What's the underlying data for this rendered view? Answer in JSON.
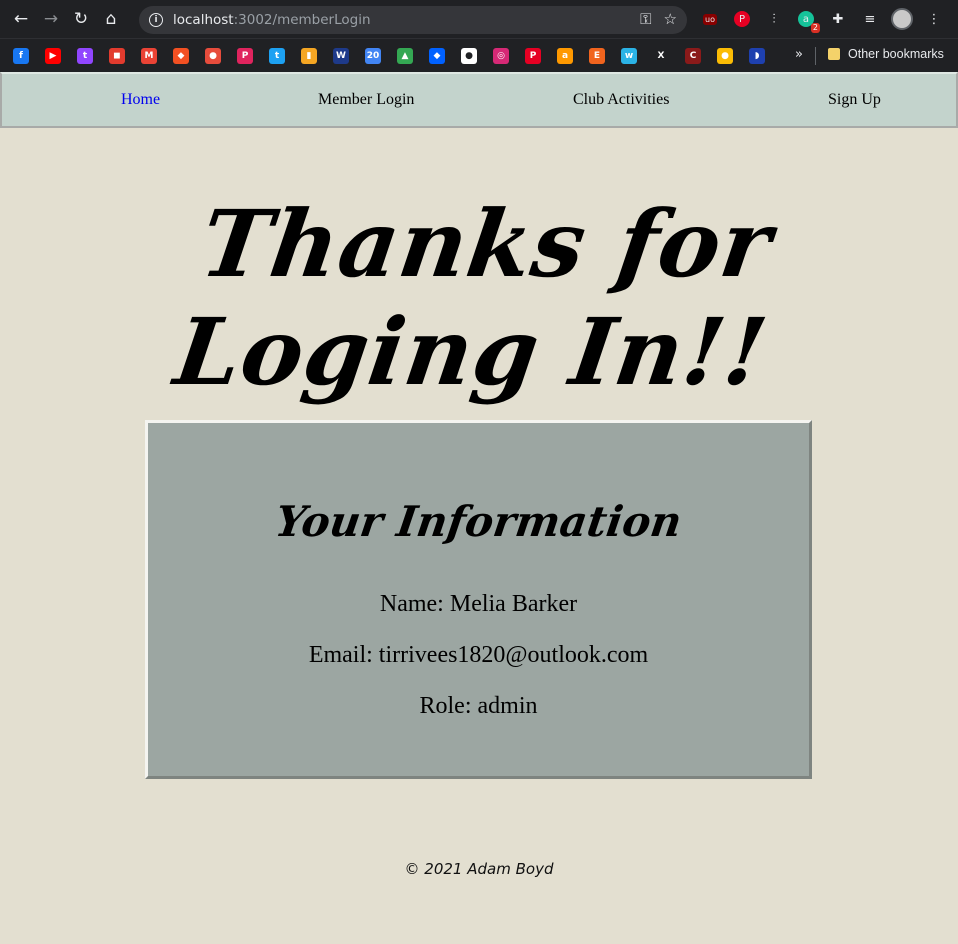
{
  "browser": {
    "url_host": "localhost",
    "url_path": ":3002/memberLogin",
    "other_bookmarks_label": "Other bookmarks",
    "more_chevron": "»",
    "extension_badge": "2",
    "icons": [
      "back-icon",
      "forward-icon",
      "reload-icon",
      "home-icon",
      "info-icon",
      "key-icon",
      "star-icon"
    ],
    "bookmark_icons": [
      {
        "name": "facebook-bookmark-icon",
        "color": "#1877f2",
        "glyph": "f"
      },
      {
        "name": "youtube-bookmark-icon",
        "color": "#ff0000",
        "glyph": "▶"
      },
      {
        "name": "twitch-bookmark-icon",
        "color": "#9146ff",
        "glyph": "t"
      },
      {
        "name": "bookmark-icon-4",
        "color": "#e23b2e",
        "glyph": "◼"
      },
      {
        "name": "gmail-bookmark-icon",
        "color": "#ea4335",
        "glyph": "M"
      },
      {
        "name": "bookmark-icon-6",
        "color": "#f25022",
        "glyph": "◆"
      },
      {
        "name": "tomato-bookmark-icon",
        "color": "#e74c3c",
        "glyph": "●"
      },
      {
        "name": "bookmark-icon-8",
        "color": "#e0245e",
        "glyph": "P"
      },
      {
        "name": "twitter-bookmark-icon",
        "color": "#1da1f2",
        "glyph": "t"
      },
      {
        "name": "bookmark-icon-10",
        "color": "#f5a623",
        "glyph": "▮"
      },
      {
        "name": "weather-bookmark-icon",
        "color": "#1e3a8a",
        "glyph": "W"
      },
      {
        "name": "calendar-bookmark-icon",
        "color": "#4285f4",
        "glyph": "20"
      },
      {
        "name": "drive-bookmark-icon",
        "color": "#34a853",
        "glyph": "▲"
      },
      {
        "name": "dropbox-bookmark-icon",
        "color": "#0061ff",
        "glyph": "◆"
      },
      {
        "name": "github-bookmark-icon",
        "color": "#ffffff",
        "glyph": "●"
      },
      {
        "name": "instagram-bookmark-icon",
        "color": "#d62976",
        "glyph": "◎"
      },
      {
        "name": "pinterest-bookmark-icon",
        "color": "#e60023",
        "glyph": "P"
      },
      {
        "name": "amazon-bookmark-icon",
        "color": "#ff9900",
        "glyph": "a"
      },
      {
        "name": "etsy-bookmark-icon",
        "color": "#f1641e",
        "glyph": "E"
      },
      {
        "name": "bookmark-icon-20",
        "color": "#2bb3e6",
        "glyph": "w"
      },
      {
        "name": "x-bookmark-icon",
        "color": "#202124",
        "glyph": "X"
      },
      {
        "name": "bookmark-icon-22",
        "color": "#8b1a1a",
        "glyph": "C"
      },
      {
        "name": "chrome-bookmark-icon",
        "color": "#fbbc05",
        "glyph": "●"
      },
      {
        "name": "bookmark-icon-24",
        "color": "#1e40af",
        "glyph": "◗"
      }
    ]
  },
  "nav": {
    "items": [
      {
        "label": "Home"
      },
      {
        "label": "Member Login"
      },
      {
        "label": "Club Activities"
      },
      {
        "label": "Sign Up"
      }
    ]
  },
  "headline": "Thanks for Loging In!!",
  "card": {
    "title": "Your Information",
    "name_line": "Name: Melia Barker",
    "email_line": "Email: tirrivees1820@outlook.com",
    "role_line": "Role: admin"
  },
  "footer": "© 2021 Adam Boyd",
  "colors": {
    "page_bg": "#e3dfd0",
    "nav_bg": "#c3d3cc",
    "card_bg": "#9ca6a2",
    "active_link": "#0000ee"
  }
}
